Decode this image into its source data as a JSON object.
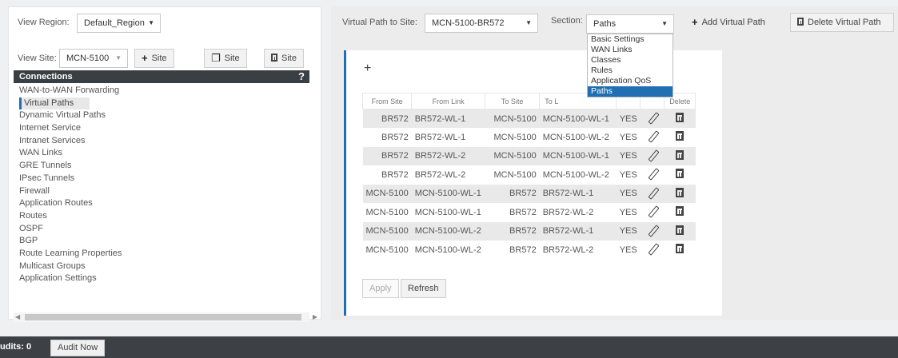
{
  "left": {
    "view_region_label": "View Region:",
    "view_region_value": "Default_Region",
    "view_site_label": "View Site:",
    "view_site_value": "MCN-5100",
    "site_add_label": "Site",
    "site_copy_label": "Site",
    "site_delete_label": "Site",
    "connections_header": "Connections",
    "help_glyph": "?",
    "connections": [
      "WAN-to-WAN Forwarding",
      "Virtual Paths",
      "Dynamic Virtual Paths",
      "Internet Service",
      "Intranet Services",
      "WAN Links",
      "GRE Tunnels",
      "IPsec Tunnels",
      "Firewall",
      "Application Routes",
      "Routes",
      "OSPF",
      "BGP",
      "Route Learning Properties",
      "Multicast Groups",
      "Application Settings"
    ],
    "active_connection": "Virtual Paths"
  },
  "top": {
    "virtual_path_label": "Virtual Path to Site:",
    "virtual_path_value": "MCN-5100-BR572",
    "section_label": "Section:",
    "section_value": "Paths",
    "add_virtual_path": "Add Virtual Path",
    "delete_virtual_path": "Delete Virtual Path"
  },
  "section_options": [
    "Basic Settings",
    "WAN Links",
    "Classes",
    "Rules",
    "Application QoS",
    "Paths"
  ],
  "table": {
    "add_glyph": "+",
    "headers": [
      "From Site",
      "From Link",
      "To Site",
      "To L",
      "",
      "",
      "Delete"
    ],
    "rows": [
      {
        "from_site": "BR572",
        "from_link": "BR572-WL-1",
        "to_site": "MCN-5100",
        "to_link": "MCN-5100-WL-1",
        "enabled": "YES"
      },
      {
        "from_site": "BR572",
        "from_link": "BR572-WL-1",
        "to_site": "MCN-5100",
        "to_link": "MCN-5100-WL-2",
        "enabled": "YES"
      },
      {
        "from_site": "BR572",
        "from_link": "BR572-WL-2",
        "to_site": "MCN-5100",
        "to_link": "MCN-5100-WL-1",
        "enabled": "YES"
      },
      {
        "from_site": "BR572",
        "from_link": "BR572-WL-2",
        "to_site": "MCN-5100",
        "to_link": "MCN-5100-WL-2",
        "enabled": "YES"
      },
      {
        "from_site": "MCN-5100",
        "from_link": "MCN-5100-WL-1",
        "to_site": "BR572",
        "to_link": "BR572-WL-1",
        "enabled": "YES"
      },
      {
        "from_site": "MCN-5100",
        "from_link": "MCN-5100-WL-1",
        "to_site": "BR572",
        "to_link": "BR572-WL-2",
        "enabled": "YES"
      },
      {
        "from_site": "MCN-5100",
        "from_link": "MCN-5100-WL-2",
        "to_site": "BR572",
        "to_link": "BR572-WL-1",
        "enabled": "YES"
      },
      {
        "from_site": "MCN-5100",
        "from_link": "MCN-5100-WL-2",
        "to_site": "BR572",
        "to_link": "BR572-WL-2",
        "enabled": "YES"
      }
    ],
    "apply_label": "Apply",
    "refresh_label": "Refresh"
  },
  "footer": {
    "audits_label": "udits:",
    "audits_count": "0",
    "audit_now_label": "Audit Now"
  },
  "colors": {
    "accent": "#1f6fb2",
    "header_bg": "#3a3f44",
    "footer_bg": "#3d4145"
  },
  "icons": [
    "plus-icon",
    "copy-icon",
    "trash-icon",
    "pencil-icon",
    "help-icon",
    "caret-down-icon"
  ]
}
